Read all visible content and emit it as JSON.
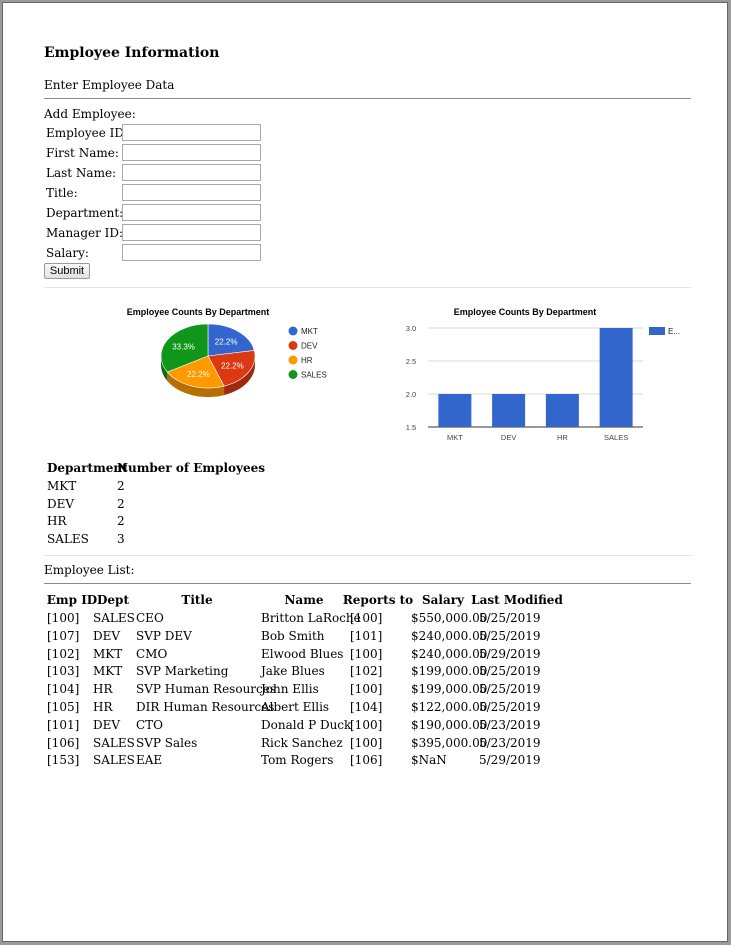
{
  "page": {
    "heading": "Employee Information",
    "enter_section": "Enter Employee Data",
    "list_section": "Employee List:"
  },
  "form": {
    "caption": "Add Employee:",
    "fields": [
      {
        "label": "Employee ID:",
        "value": ""
      },
      {
        "label": "First Name:",
        "value": ""
      },
      {
        "label": "Last Name:",
        "value": ""
      },
      {
        "label": "Title:",
        "value": ""
      },
      {
        "label": "Department:",
        "value": ""
      },
      {
        "label": "Manager ID:",
        "value": ""
      },
      {
        "label": "Salary:",
        "value": ""
      }
    ],
    "submit_label": "Submit"
  },
  "chart_data": [
    {
      "type": "pie",
      "title": "Employee Counts By Department",
      "labels": [
        "MKT",
        "DEV",
        "HR",
        "SALES"
      ],
      "values": [
        2,
        2,
        2,
        3
      ],
      "percent_labels": [
        "22.2%",
        "22.2%",
        "22.2%",
        "33.3%"
      ],
      "colors": [
        "#3366cc",
        "#dc3912",
        "#ff9900",
        "#109618"
      ],
      "legend_position": "right"
    },
    {
      "type": "bar",
      "title": "Employee Counts By Department",
      "categories": [
        "MKT",
        "DEV",
        "HR",
        "SALES"
      ],
      "series": [
        {
          "name": "E...",
          "values": [
            2,
            2,
            2,
            3
          ]
        }
      ],
      "ylim": [
        1.5,
        3.0
      ],
      "yticks": [
        "3.0",
        "2.5",
        "2.0",
        "1.5"
      ],
      "color": "#3366cc",
      "grid": true,
      "legend_position": "top-right"
    }
  ],
  "dept_table": {
    "headers": [
      "Department",
      "Number of Employees"
    ],
    "rows": [
      [
        "MKT",
        "2"
      ],
      [
        "DEV",
        "2"
      ],
      [
        "HR",
        "2"
      ],
      [
        "SALES",
        "3"
      ]
    ]
  },
  "employees": {
    "headers": [
      "Emp ID",
      "Dept",
      "Title",
      "Name",
      "Reports to",
      "Salary",
      "Last Modified"
    ],
    "rows": [
      [
        "[100]",
        "SALES",
        "CEO",
        "Britton LaRoche",
        "[100]",
        "$550,000.00",
        "5/25/2019"
      ],
      [
        "[107]",
        "DEV",
        "SVP DEV",
        "Bob Smith",
        "[101]",
        "$240,000.00",
        "5/25/2019"
      ],
      [
        "[102]",
        "MKT",
        "CMO",
        "Elwood Blues",
        "[100]",
        "$240,000.00",
        "5/29/2019"
      ],
      [
        "[103]",
        "MKT",
        "SVP Marketing",
        "Jake Blues",
        "[102]",
        "$199,000.00",
        "5/25/2019"
      ],
      [
        "[104]",
        "HR",
        "SVP Human Resources",
        "John Ellis",
        "[100]",
        "$199,000.00",
        "5/25/2019"
      ],
      [
        "[105]",
        "HR",
        "DIR Human Resources",
        "Albert Ellis",
        "[104]",
        "$122,000.00",
        "5/25/2019"
      ],
      [
        "[101]",
        "DEV",
        "CTO",
        "Donald P Duck",
        "[100]",
        "$190,000.00",
        "5/23/2019"
      ],
      [
        "[106]",
        "SALES",
        "SVP Sales",
        "Rick Sanchez",
        "[100]",
        "$395,000.00",
        "5/23/2019"
      ],
      [
        "[153]",
        "SALES",
        "EAE",
        "Tom Rogers",
        "[106]",
        "$NaN",
        "5/29/2019"
      ]
    ]
  }
}
